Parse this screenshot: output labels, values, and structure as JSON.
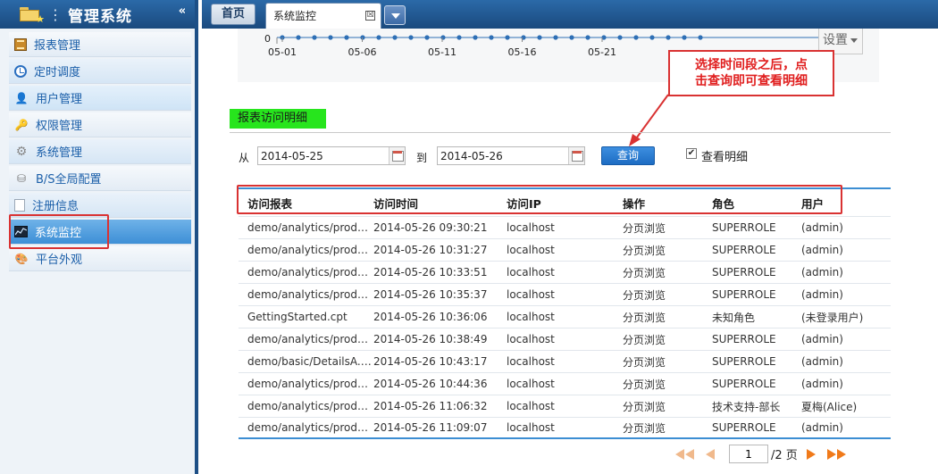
{
  "sidebar": {
    "title": "管理系统",
    "collapse_glyph": "«",
    "items": [
      {
        "label": "报表管理"
      },
      {
        "label": "定时调度"
      },
      {
        "label": "用户管理"
      },
      {
        "label": "权限管理"
      },
      {
        "label": "系统管理"
      },
      {
        "label": "B/S全局配置"
      },
      {
        "label": "注册信息"
      },
      {
        "label": "系统监控"
      },
      {
        "label": "平台外观"
      }
    ]
  },
  "tabs": {
    "home": "首页",
    "active": "系统监控",
    "close_glyph": "☒"
  },
  "chart": {
    "y_zero_label": "0",
    "x_labels": [
      "05-01",
      "05-06",
      "05-11",
      "05-16",
      "05-21"
    ],
    "settings_label": "设置"
  },
  "callout": {
    "line1": "选择时间段之后，点",
    "line2": "击查询即可查看明细"
  },
  "section": {
    "title": "报表访问明细"
  },
  "filter": {
    "from_label": "从",
    "from_value": "2014-05-25",
    "to_label": "到",
    "to_value": "2014-05-26",
    "query_label": "查询",
    "detail_label": "查看明细",
    "detail_checked": "✔"
  },
  "table": {
    "headers": [
      "访问报表",
      "访问时间",
      "访问IP",
      "操作",
      "角色",
      "用户"
    ],
    "rows": [
      [
        "demo/analytics/product...",
        "2014-05-26 09:30:21",
        "localhost",
        "分页浏览",
        "SUPERROLE",
        "(admin)"
      ],
      [
        "demo/analytics/product...",
        "2014-05-26 10:31:27",
        "localhost",
        "分页浏览",
        "SUPERROLE",
        "(admin)"
      ],
      [
        "demo/analytics/product...",
        "2014-05-26 10:33:51",
        "localhost",
        "分页浏览",
        "SUPERROLE",
        "(admin)"
      ],
      [
        "demo/analytics/product...",
        "2014-05-26 10:35:37",
        "localhost",
        "分页浏览",
        "SUPERROLE",
        "(admin)"
      ],
      [
        "GettingStarted.cpt",
        "2014-05-26 10:36:06",
        "localhost",
        "分页浏览",
        "未知角色",
        "(未登录用户)"
      ],
      [
        "demo/analytics/product...",
        "2014-05-26 10:38:49",
        "localhost",
        "分页浏览",
        "SUPERROLE",
        "(admin)"
      ],
      [
        "demo/basic/DetailsA.cpt",
        "2014-05-26 10:43:17",
        "localhost",
        "分页浏览",
        "SUPERROLE",
        "(admin)"
      ],
      [
        "demo/analytics/product...",
        "2014-05-26 10:44:36",
        "localhost",
        "分页浏览",
        "SUPERROLE",
        "(admin)"
      ],
      [
        "demo/analytics/product...",
        "2014-05-26 11:06:32",
        "localhost",
        "分页浏览",
        "技术支持-部长",
        "夏梅(Alice)"
      ],
      [
        "demo/analytics/product...",
        "2014-05-26 11:09:07",
        "localhost",
        "分页浏览",
        "SUPERROLE",
        "(admin)"
      ]
    ]
  },
  "pager": {
    "current_page": "1",
    "total_label": "/2 页"
  },
  "colors": {
    "accent_blue": "#3c8ed3",
    "header_blue": "#1a4a7e",
    "callout_red": "#d93232",
    "section_green": "#27e51d"
  }
}
